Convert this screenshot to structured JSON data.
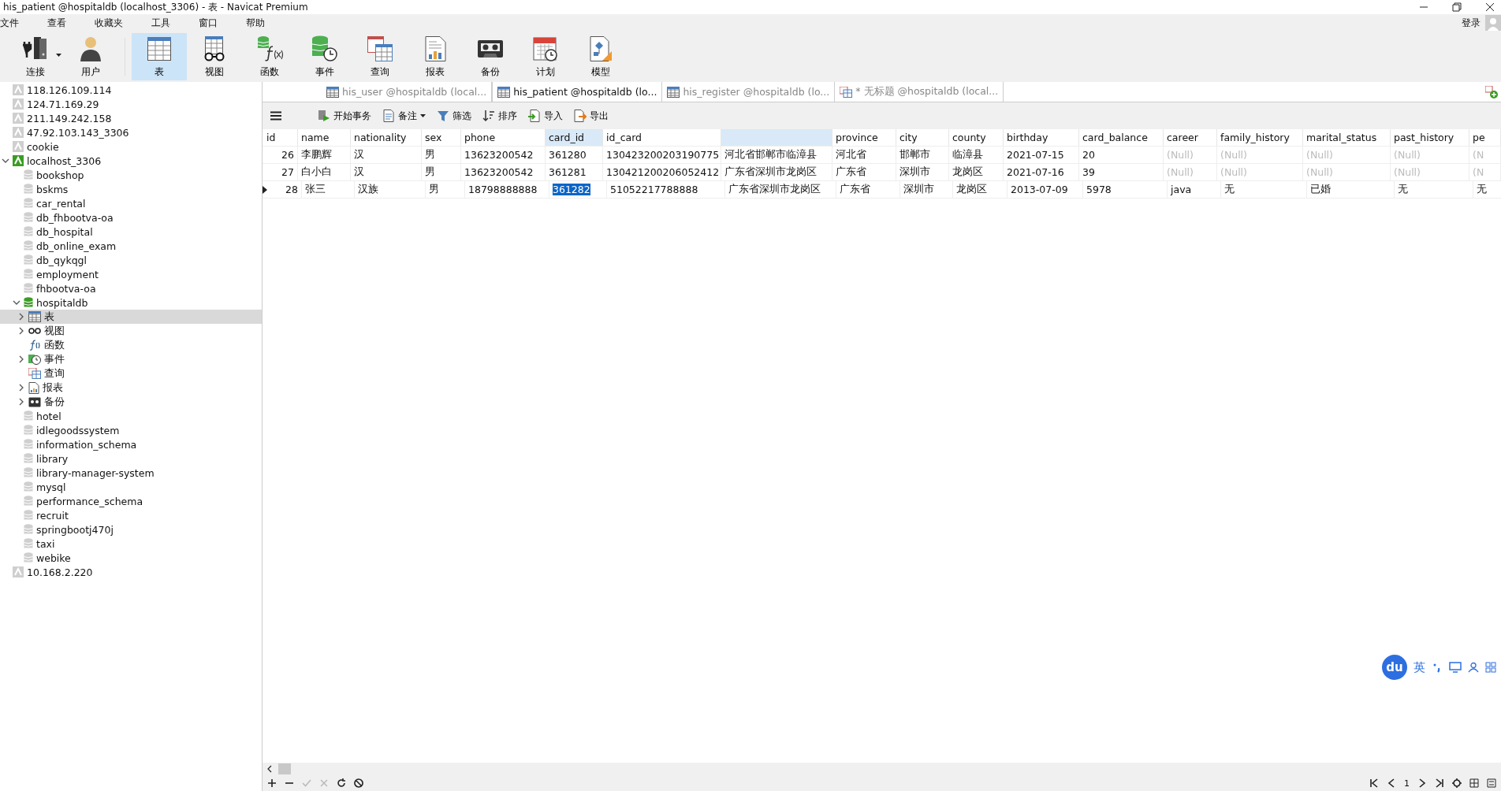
{
  "window": {
    "title": "his_patient @hospitaldb (localhost_3306) - 表 - Navicat Premium"
  },
  "menu": [
    "文件",
    "查看",
    "收藏夹",
    "工具",
    "窗口",
    "帮助"
  ],
  "login": "登录",
  "toolbar": [
    {
      "kind": "connect",
      "label": "连接",
      "selected": false,
      "dropdown": true
    },
    {
      "kind": "user",
      "label": "用户",
      "selected": false
    },
    {
      "kind": "table",
      "label": "表",
      "selected": true
    },
    {
      "kind": "view",
      "label": "视图",
      "selected": false
    },
    {
      "kind": "function",
      "label": "函数",
      "selected": false
    },
    {
      "kind": "event",
      "label": "事件",
      "selected": false
    },
    {
      "kind": "query",
      "label": "查询",
      "selected": false
    },
    {
      "kind": "report",
      "label": "报表",
      "selected": false
    },
    {
      "kind": "backup",
      "label": "备份",
      "selected": false
    },
    {
      "kind": "schedule",
      "label": "计划",
      "selected": false
    },
    {
      "kind": "model",
      "label": "模型",
      "selected": false
    }
  ],
  "sidebar": {
    "items": [
      {
        "kind": "connection",
        "label": "118.126.109.114",
        "selected": false
      },
      {
        "kind": "connection",
        "label": "124.71.169.29",
        "selected": false
      },
      {
        "kind": "connection",
        "label": "211.149.242.158",
        "selected": false
      },
      {
        "kind": "connection",
        "label": "47.92.103.143_3306",
        "selected": false
      },
      {
        "kind": "connection",
        "label": "cookie",
        "selected": false
      },
      {
        "kind": "connection",
        "label": "localhost_3306",
        "expanded": true,
        "selected": false,
        "children": [
          {
            "kind": "database",
            "label": "bookshop",
            "selected": false
          },
          {
            "kind": "database",
            "label": "bskms",
            "selected": false
          },
          {
            "kind": "database",
            "label": "car_rental",
            "selected": false
          },
          {
            "kind": "database",
            "label": "db_fhbootva-oa",
            "selected": false
          },
          {
            "kind": "database",
            "label": "db_hospital",
            "selected": false
          },
          {
            "kind": "database",
            "label": "db_online_exam",
            "selected": false
          },
          {
            "kind": "database",
            "label": "db_qykqgl",
            "selected": false
          },
          {
            "kind": "database",
            "label": "employment",
            "selected": false
          },
          {
            "kind": "database",
            "label": "fhbootva-oa",
            "selected": false
          },
          {
            "kind": "database",
            "label": "hospitaldb",
            "expanded": true,
            "selected": false,
            "children": [
              {
                "kind": "table",
                "label": "表",
                "expanded": false,
                "selected": true
              },
              {
                "kind": "view",
                "label": "视图",
                "expanded": false,
                "selected": false
              },
              {
                "kind": "function",
                "label": "函数",
                "selected": false
              },
              {
                "kind": "event",
                "label": "事件",
                "expanded": false,
                "selected": false
              },
              {
                "kind": "query",
                "label": "查询",
                "selected": false
              },
              {
                "kind": "report",
                "label": "报表",
                "expanded": false,
                "selected": false
              },
              {
                "kind": "backup",
                "label": "备份",
                "expanded": false,
                "selected": false
              }
            ]
          },
          {
            "kind": "database",
            "label": "hotel",
            "selected": false
          },
          {
            "kind": "database",
            "label": "idlegoodssystem",
            "selected": false
          },
          {
            "kind": "database",
            "label": "information_schema",
            "selected": false
          },
          {
            "kind": "database",
            "label": "library",
            "selected": false
          },
          {
            "kind": "database",
            "label": "library-manager-system",
            "selected": false
          },
          {
            "kind": "database",
            "label": "mysql",
            "selected": false
          },
          {
            "kind": "database",
            "label": "performance_schema",
            "selected": false
          },
          {
            "kind": "database",
            "label": "recruit",
            "selected": false
          },
          {
            "kind": "database",
            "label": "springbootj470j",
            "selected": false
          },
          {
            "kind": "database",
            "label": "taxi",
            "selected": false
          },
          {
            "kind": "database",
            "label": "webike",
            "selected": false
          }
        ]
      },
      {
        "kind": "ssh",
        "label": "10.168.2.220",
        "selected": false
      }
    ]
  },
  "tabs": [
    {
      "kind": "table",
      "label": "his_user @hospitaldb (local...",
      "selected": false
    },
    {
      "kind": "table",
      "label": "his_patient @hospitaldb (lo...",
      "selected": true
    },
    {
      "kind": "table",
      "label": "his_register @hospitaldb (lo...",
      "selected": false
    },
    {
      "kind": "query",
      "label": "* 无标题 @hospitaldb (local...",
      "selected": false
    }
  ],
  "table_toolbar": [
    {
      "kind": "transaction",
      "label": "开始事务"
    },
    {
      "kind": "note",
      "label": "备注",
      "dropdown": true
    },
    {
      "kind": "filter",
      "label": "筛选"
    },
    {
      "kind": "sort",
      "label": "排序"
    },
    {
      "kind": "import",
      "label": "导入"
    },
    {
      "kind": "export",
      "label": "导出"
    }
  ],
  "table": {
    "columns": [
      {
        "label": "id",
        "highlighted": false
      },
      {
        "label": "name",
        "highlighted": false
      },
      {
        "label": "nationality",
        "highlighted": false
      },
      {
        "label": "sex",
        "highlighted": false
      },
      {
        "label": "phone",
        "highlighted": false
      },
      {
        "label": "card_id",
        "highlighted": true
      },
      {
        "label": "id_card",
        "highlighted": false
      },
      {
        "highlighted": true
      },
      {
        "label": "province",
        "highlighted": false
      },
      {
        "label": "city",
        "highlighted": false
      },
      {
        "label": "county",
        "highlighted": false
      },
      {
        "label": "birthday",
        "highlighted": false
      },
      {
        "label": "card_balance",
        "highlighted": false
      },
      {
        "label": "career",
        "highlighted": false
      },
      {
        "label": "family_history",
        "highlighted": false
      },
      {
        "label": "marital_status",
        "highlighted": false
      },
      {
        "label": "past_history",
        "highlighted": false
      },
      {
        "label": "pe",
        "highlighted": false
      }
    ],
    "rows": [
      {
        "current": false,
        "cells": [
          {
            "text": "26",
            "null": false,
            "selected": false
          },
          {
            "text": "李鹏辉",
            "null": false,
            "selected": false
          },
          {
            "text": "汉",
            "null": false,
            "selected": false
          },
          {
            "text": "男",
            "null": false,
            "selected": false
          },
          {
            "text": "13623200542",
            "null": false,
            "selected": false
          },
          {
            "text": "361280",
            "null": false,
            "selected": false
          },
          {
            "text": "130423200203190775",
            "null": false,
            "selected": false
          },
          {
            "text": "河北省邯郸市临漳县",
            "null": false,
            "selected": false
          },
          {
            "text": "河北省",
            "null": false,
            "selected": false
          },
          {
            "text": "邯郸市",
            "null": false,
            "selected": false
          },
          {
            "text": "临漳县",
            "null": false,
            "selected": false
          },
          {
            "text": "2021-07-15",
            "null": false,
            "selected": false
          },
          {
            "text": "20",
            "null": false,
            "selected": false
          },
          {
            "text": "(Null)",
            "null": true,
            "selected": false
          },
          {
            "text": "(Null)",
            "null": true,
            "selected": false
          },
          {
            "text": "(Null)",
            "null": true,
            "selected": false
          },
          {
            "text": "(Null)",
            "null": true,
            "selected": false
          },
          {
            "text": "(N",
            "null": true,
            "selected": false
          }
        ]
      },
      {
        "current": false,
        "cells": [
          {
            "text": "27",
            "null": false,
            "selected": false
          },
          {
            "text": "白小白",
            "null": false,
            "selected": false
          },
          {
            "text": "汉",
            "null": false,
            "selected": false
          },
          {
            "text": "男",
            "null": false,
            "selected": false
          },
          {
            "text": "13623200542",
            "null": false,
            "selected": false
          },
          {
            "text": "361281",
            "null": false,
            "selected": false
          },
          {
            "text": "130421200206052412",
            "null": false,
            "selected": false
          },
          {
            "text": "广东省深圳市龙岗区",
            "null": false,
            "selected": false
          },
          {
            "text": "广东省",
            "null": false,
            "selected": false
          },
          {
            "text": "深圳市",
            "null": false,
            "selected": false
          },
          {
            "text": "龙岗区",
            "null": false,
            "selected": false
          },
          {
            "text": "2021-07-16",
            "null": false,
            "selected": false
          },
          {
            "text": "39",
            "null": false,
            "selected": false
          },
          {
            "text": "(Null)",
            "null": true,
            "selected": false
          },
          {
            "text": "(Null)",
            "null": true,
            "selected": false
          },
          {
            "text": "(Null)",
            "null": true,
            "selected": false
          },
          {
            "text": "(Null)",
            "null": true,
            "selected": false
          },
          {
            "text": "(N",
            "null": true,
            "selected": false
          }
        ]
      },
      {
        "current": true,
        "cells": [
          {
            "text": "28",
            "null": false,
            "selected": false
          },
          {
            "text": "张三",
            "null": false,
            "selected": false
          },
          {
            "text": "汉族",
            "null": false,
            "selected": false
          },
          {
            "text": "男",
            "null": false,
            "selected": false
          },
          {
            "text": "18798888888",
            "null": false,
            "selected": false
          },
          {
            "text": "361282",
            "null": false,
            "selected": true
          },
          {
            "text": "51052217788888",
            "null": false,
            "selected": false
          },
          {
            "text": "广东省深圳市龙岗区",
            "null": false,
            "selected": false
          },
          {
            "text": "广东省",
            "null": false,
            "selected": false
          },
          {
            "text": "深圳市",
            "null": false,
            "selected": false
          },
          {
            "text": "龙岗区",
            "null": false,
            "selected": false
          },
          {
            "text": "2013-07-09",
            "null": false,
            "selected": false
          },
          {
            "text": "5978",
            "null": false,
            "selected": false
          },
          {
            "text": "java",
            "null": false,
            "selected": false
          },
          {
            "text": "无",
            "null": false,
            "selected": false
          },
          {
            "text": "已婚",
            "null": false,
            "selected": false
          },
          {
            "text": "无",
            "null": false,
            "selected": false
          },
          {
            "text": "无",
            "null": false,
            "selected": false
          }
        ]
      }
    ]
  },
  "bottom_bar": {
    "page": "1"
  },
  "ime": {
    "logo": "du",
    "language": "英"
  }
}
